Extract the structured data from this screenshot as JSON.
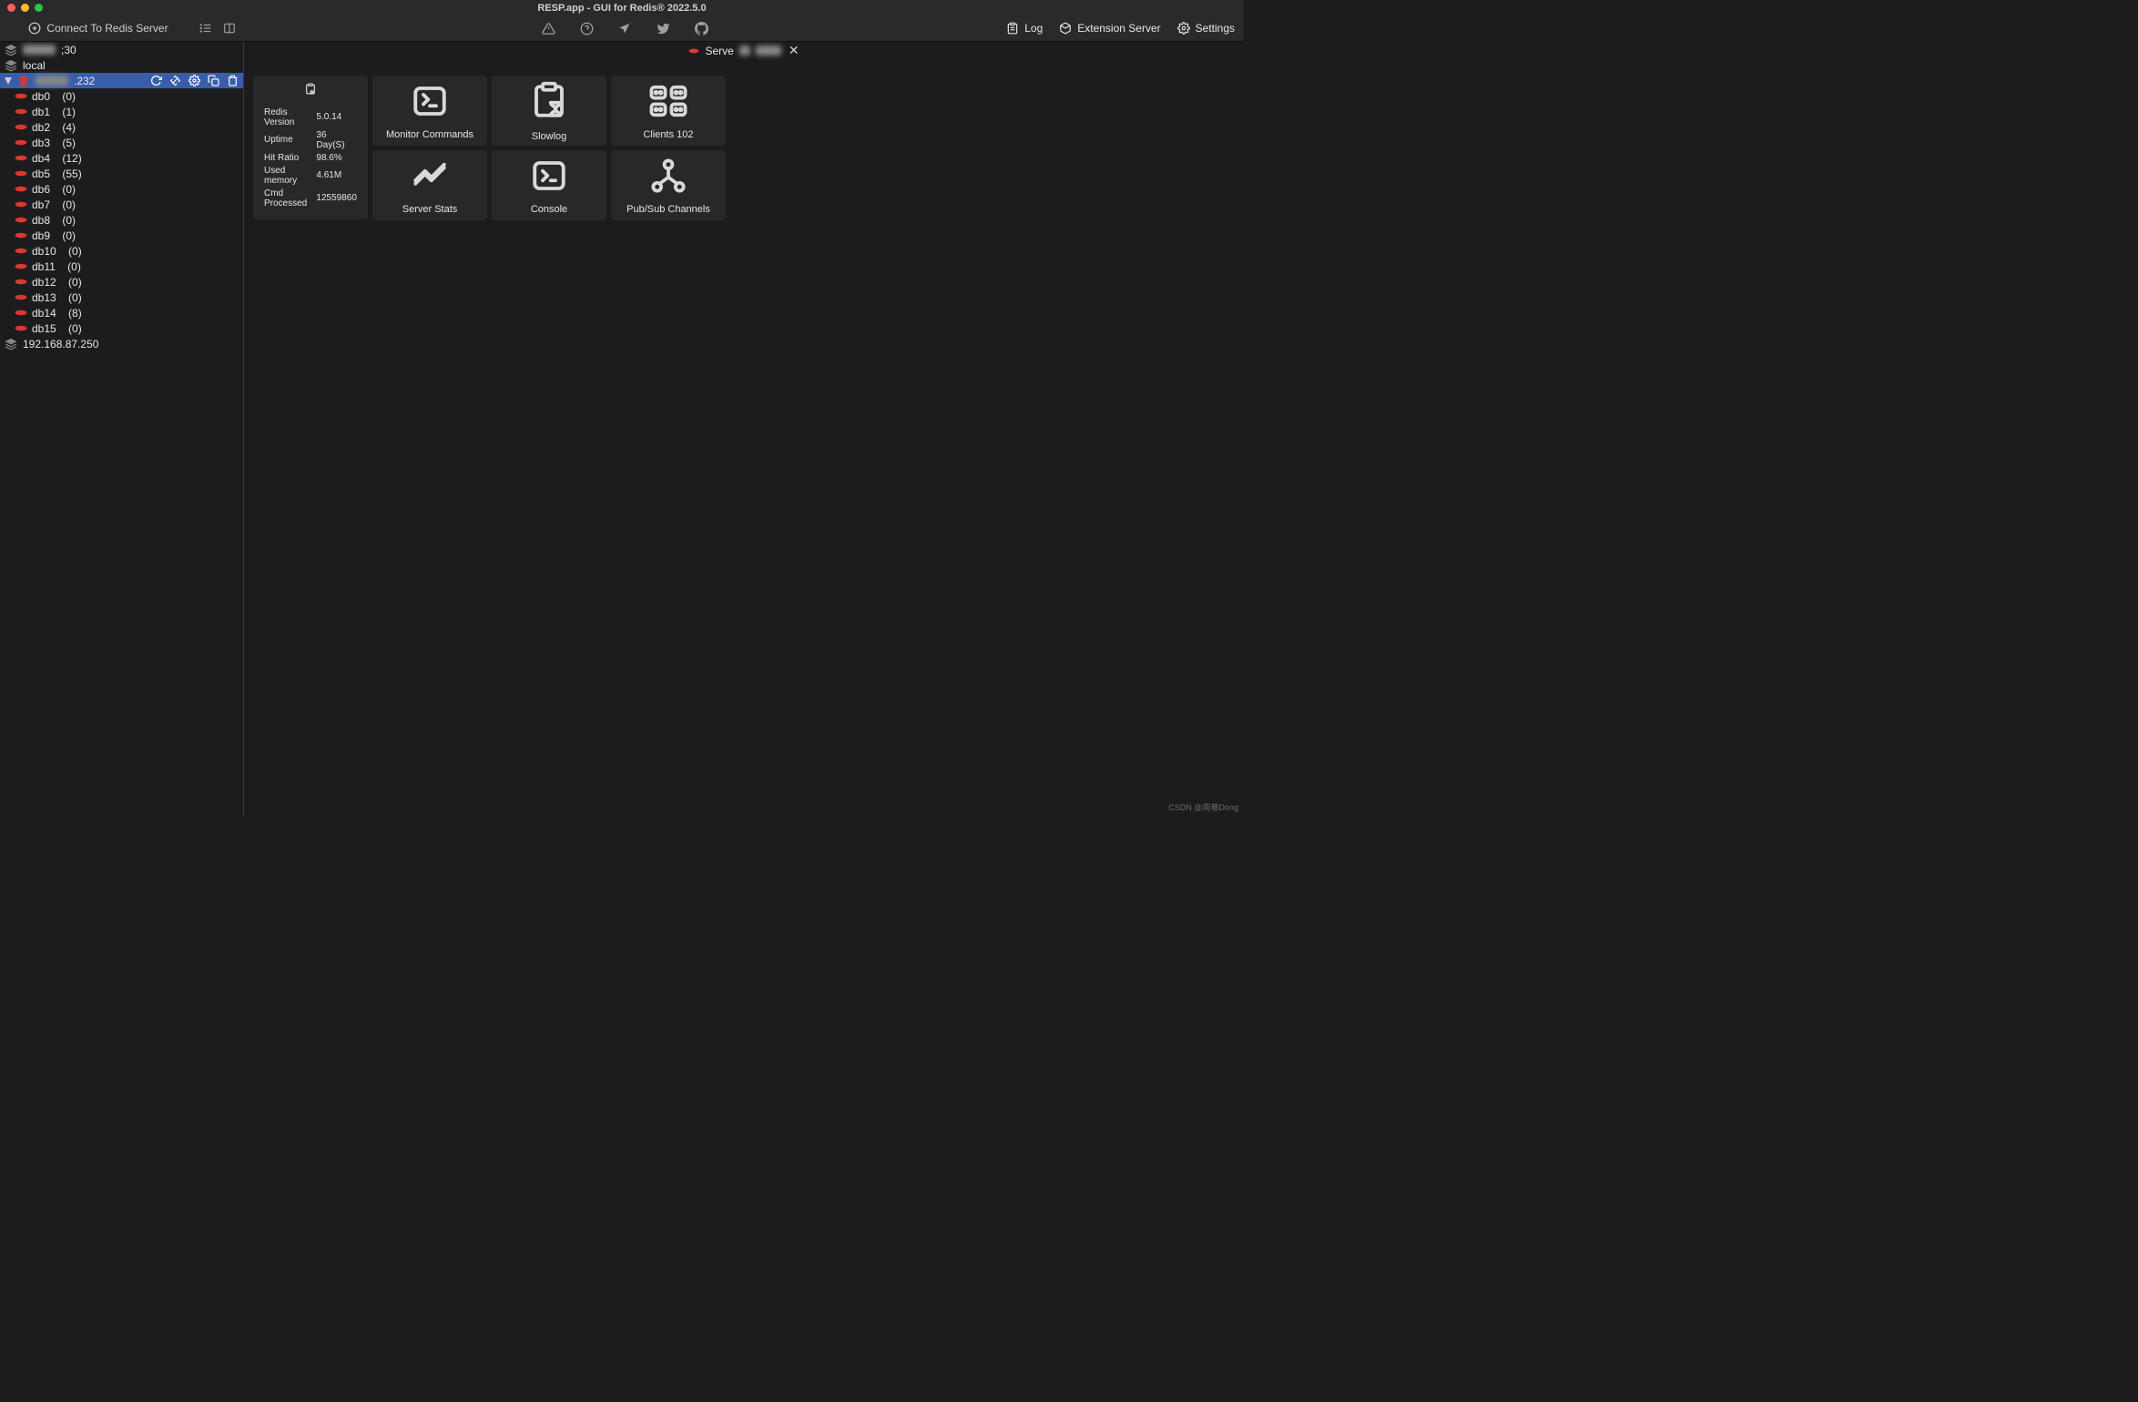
{
  "title": "RESP.app - GUI for Redis® 2022.5.0",
  "toolbar": {
    "connect": "Connect To Redis Server",
    "log": "Log",
    "extension_server": "Extension Server",
    "settings": "Settings"
  },
  "sidebar": {
    "servers": [
      {
        "name": "30",
        "blurred": true,
        "suffix": ";30"
      },
      {
        "name": "local"
      },
      {
        "name": ".232",
        "blurred": true,
        "prefix_hidden": true,
        "selected": true,
        "expanded": true,
        "dbs": [
          {
            "name": "db0",
            "count": 0
          },
          {
            "name": "db1",
            "count": 1
          },
          {
            "name": "db2",
            "count": 4
          },
          {
            "name": "db3",
            "count": 5
          },
          {
            "name": "db4",
            "count": 12
          },
          {
            "name": "db5",
            "count": 55
          },
          {
            "name": "db6",
            "count": 0
          },
          {
            "name": "db7",
            "count": 0
          },
          {
            "name": "db8",
            "count": 0
          },
          {
            "name": "db9",
            "count": 0
          },
          {
            "name": "db10",
            "count": 0
          },
          {
            "name": "db11",
            "count": 0
          },
          {
            "name": "db12",
            "count": 0
          },
          {
            "name": "db13",
            "count": 0
          },
          {
            "name": "db14",
            "count": 8
          },
          {
            "name": "db15",
            "count": 0
          }
        ]
      },
      {
        "name": "192.168.87.250"
      }
    ]
  },
  "tab": {
    "label": "Serve"
  },
  "info": {
    "rows": [
      {
        "label": "Redis Version",
        "value": "5.0.14"
      },
      {
        "label": "Uptime",
        "value": "36 Day(S)"
      },
      {
        "label": "Hit Ratio",
        "value": "98.6%"
      },
      {
        "label": "Used memory",
        "value": "4.61M"
      },
      {
        "label": "Cmd Processed",
        "value": "12559860"
      }
    ]
  },
  "cards": {
    "monitor": "Monitor Commands",
    "slowlog": "Slowlog",
    "clients": "Clients 102",
    "server_stats": "Server Stats",
    "console": "Console",
    "pubsub": "Pub/Sub Channels"
  },
  "watermark": "CSDN @南巷Dong"
}
